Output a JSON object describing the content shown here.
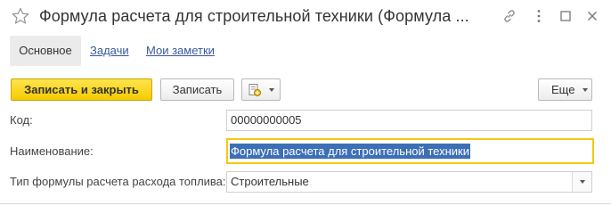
{
  "window": {
    "title": "Формула расчета для строительной техники (Формула ..."
  },
  "tabs": [
    {
      "label": "Основное"
    },
    {
      "label": "Задачи"
    },
    {
      "label": "Мои заметки"
    }
  ],
  "toolbar": {
    "save_close_label": "Записать и закрыть",
    "save_label": "Записать",
    "more_label": "Еще"
  },
  "form": {
    "code_label": "Код:",
    "code_value": "00000000005",
    "name_label": "Наименование:",
    "name_value": "Формула расчета для строительной техники",
    "type_label": "Тип формулы расчета расхода топлива:",
    "type_value": "Строительные"
  },
  "colors": {
    "primary_button": "#f5cb00",
    "focus_border": "#f2c80f",
    "selection": "#3d6fb6",
    "link": "#3a5a9b"
  },
  "icons": [
    "star-icon",
    "link-icon",
    "more-icon",
    "maximize-icon",
    "close-icon",
    "report-icon",
    "chevron-down-icon"
  ]
}
